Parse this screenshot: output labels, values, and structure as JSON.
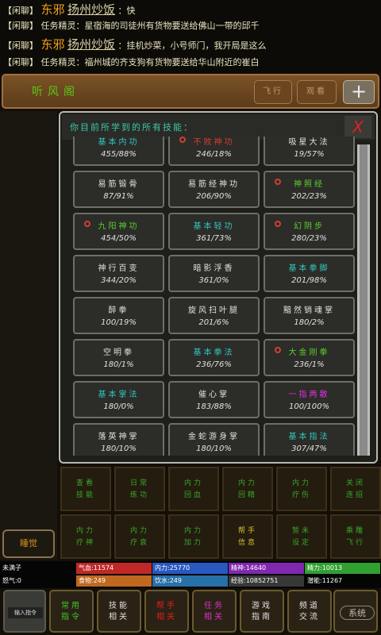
{
  "chat": [
    {
      "channel": "【闲聊】",
      "name": "东邪",
      "name2": "扬州炒饭",
      "text": "：快"
    },
    {
      "channel": "【闲聊】",
      "name": "",
      "name2": "",
      "text": "任务精灵：星宿海的司徒州有货物要送给佛山一带的邱千"
    },
    {
      "channel": "【闲聊】",
      "name": "东邪",
      "name2": "扬州炒饭",
      "text": "：挂机炒菜，小号师门，我开局是这么"
    },
    {
      "channel": "【闲聊】",
      "name": "",
      "name2": "",
      "text": "任务精灵：福州城的齐支狗有货物要送给华山附近的崔白"
    }
  ],
  "topbar": {
    "title": "听风阁",
    "btn1": "飞行",
    "btn2": "观看",
    "plus": "+"
  },
  "panel": {
    "title": "你目前所学到的所有技能：",
    "close": "X"
  },
  "skills": [
    {
      "name": "基本内功",
      "value": "455/88%",
      "color": "cyan",
      "icon": ""
    },
    {
      "name": "不败神功",
      "value": "246/18%",
      "color": "red",
      "icon": "red-circle"
    },
    {
      "name": "吸星大法",
      "value": "19/57%",
      "color": "white",
      "icon": ""
    },
    {
      "name": "易筋锻骨",
      "value": "87/91%",
      "color": "white",
      "icon": ""
    },
    {
      "name": "易筋经神功",
      "value": "206/90%",
      "color": "white",
      "icon": ""
    },
    {
      "name": "神照经",
      "value": "202/23%",
      "color": "green",
      "icon": "red-circle"
    },
    {
      "name": "九阳神功",
      "value": "454/50%",
      "color": "green",
      "icon": "red-circle"
    },
    {
      "name": "基本轻功",
      "value": "361/73%",
      "color": "cyan",
      "icon": ""
    },
    {
      "name": "幻阴步",
      "value": "280/23%",
      "color": "green",
      "icon": "red-circle"
    },
    {
      "name": "神行百变",
      "value": "344/20%",
      "color": "white",
      "icon": ""
    },
    {
      "name": "暗影浮香",
      "value": "361/0%",
      "color": "white",
      "icon": ""
    },
    {
      "name": "基本拳脚",
      "value": "201/98%",
      "color": "cyan",
      "icon": ""
    },
    {
      "name": "醉拳",
      "value": "100/19%",
      "color": "white",
      "icon": ""
    },
    {
      "name": "旋风扫叶腿",
      "value": "201/6%",
      "color": "white",
      "icon": ""
    },
    {
      "name": "黯然销魂掌",
      "value": "180/2%",
      "color": "white",
      "icon": ""
    },
    {
      "name": "空明拳",
      "value": "180/1%",
      "color": "white",
      "icon": ""
    },
    {
      "name": "基本拳法",
      "value": "236/76%",
      "color": "cyan",
      "icon": ""
    },
    {
      "name": "大金刚拳",
      "value": "236/1%",
      "color": "green",
      "icon": "red-circle"
    },
    {
      "name": "基本掌法",
      "value": "180/0%",
      "color": "cyan",
      "icon": ""
    },
    {
      "name": "催心掌",
      "value": "183/88%",
      "color": "white",
      "icon": ""
    },
    {
      "name": "一指两散",
      "value": "100/100%",
      "color": "magenta",
      "icon": ""
    },
    {
      "name": "落英神掌",
      "value": "180/10%",
      "color": "white",
      "icon": ""
    },
    {
      "name": "金蛇游身掌",
      "value": "180/10%",
      "color": "white",
      "icon": ""
    },
    {
      "name": "基本指法",
      "value": "307/47%",
      "color": "cyan",
      "icon": ""
    }
  ],
  "actions": [
    {
      "l1": "查看",
      "l2": "技能",
      "color": "#38a828"
    },
    {
      "l1": "日常",
      "l2": "练功",
      "color": "#38a828"
    },
    {
      "l1": "内力",
      "l2": "回血",
      "color": "#38a828"
    },
    {
      "l1": "内力",
      "l2": "回精",
      "color": "#38a828"
    },
    {
      "l1": "内力",
      "l2": "疗伤",
      "color": "#38a828"
    },
    {
      "l1": "关闭",
      "l2": "连招",
      "color": "#38a828"
    },
    {
      "l1": "内力",
      "l2": "疗神",
      "color": "#38a828"
    },
    {
      "l1": "内力",
      "l2": "疗衰",
      "color": "#38a828"
    },
    {
      "l1": "内力",
      "l2": "加力",
      "color": "#38a828"
    },
    {
      "l1": "帮手",
      "l2": "信息",
      "color": "#d8c030"
    },
    {
      "l1": "暂未",
      "l2": "设定",
      "color": "#38a828"
    },
    {
      "l1": "乘雕",
      "l2": "飞行",
      "color": "#38a828"
    }
  ],
  "sleep": "睡觉",
  "stats": [
    {
      "label": "未满子",
      "bg": "#050505",
      "color": "#fff"
    },
    {
      "label": "气血:11574",
      "bg": "#c02828",
      "color": "#fff"
    },
    {
      "label": "内力:25770",
      "bg": "#2858c0",
      "color": "#fff"
    },
    {
      "label": "精神:14640",
      "bg": "#8028b0",
      "color": "#fff"
    },
    {
      "label": "精力:10013",
      "bg": "#30a030",
      "color": "#fff"
    },
    {
      "label": "怒气:0",
      "bg": "#050505",
      "color": "#fff"
    },
    {
      "label": "食物:249",
      "bg": "#c06820",
      "color": "#fff"
    },
    {
      "label": "饮水:249",
      "bg": "#2870a8",
      "color": "#fff"
    },
    {
      "label": "经验:10852751",
      "bg": "#383838",
      "color": "#fff"
    },
    {
      "label": "潜能:11267",
      "bg": "#050505",
      "color": "#fff"
    }
  ],
  "bottom": {
    "input": "输入指令",
    "buttons": [
      {
        "l1": "常用",
        "l2": "指令",
        "color": "#40c830"
      },
      {
        "l1": "技能",
        "l2": "相关",
        "color": "#e0e0e0"
      },
      {
        "l1": "帮手",
        "l2": "相关",
        "color": "#e02020"
      },
      {
        "l1": "任务",
        "l2": "相关",
        "color": "#e030d0"
      },
      {
        "l1": "游戏",
        "l2": "指南",
        "color": "#e0e0e0"
      },
      {
        "l1": "频道",
        "l2": "交流",
        "color": "#e0e0e0"
      }
    ],
    "system": "系统"
  }
}
